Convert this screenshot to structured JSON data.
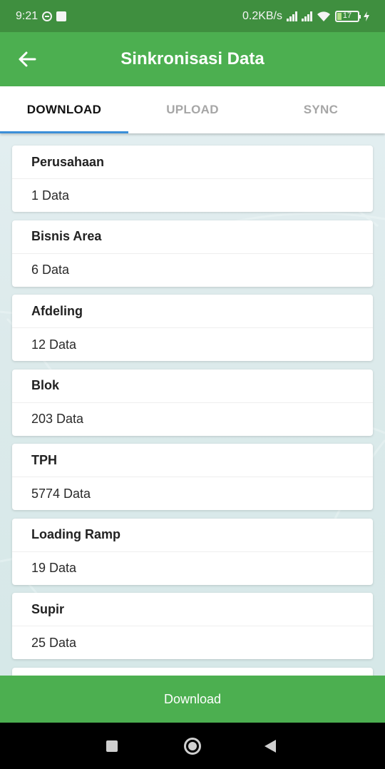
{
  "status_bar": {
    "time": "9:21",
    "net_speed": "0.2KB/s",
    "battery_level": "17"
  },
  "app_bar": {
    "title": "Sinkronisasi Data"
  },
  "tabs": [
    {
      "label": "DOWNLOAD",
      "active": true
    },
    {
      "label": "UPLOAD",
      "active": false
    },
    {
      "label": "SYNC",
      "active": false
    }
  ],
  "cards": [
    {
      "title": "Perusahaan",
      "value": "1 Data"
    },
    {
      "title": "Bisnis Area",
      "value": "6 Data"
    },
    {
      "title": "Afdeling",
      "value": "12 Data"
    },
    {
      "title": "Blok",
      "value": "203 Data"
    },
    {
      "title": "TPH",
      "value": "5774 Data"
    },
    {
      "title": "Loading Ramp",
      "value": "19 Data"
    },
    {
      "title": "Supir",
      "value": "25 Data"
    }
  ],
  "download_button": {
    "label": "Download"
  },
  "colors": {
    "status_bar": "#3f8f3f",
    "app_bar": "#4caf50",
    "tab_indicator": "#3b8fd8",
    "background": "#dceaeb"
  }
}
